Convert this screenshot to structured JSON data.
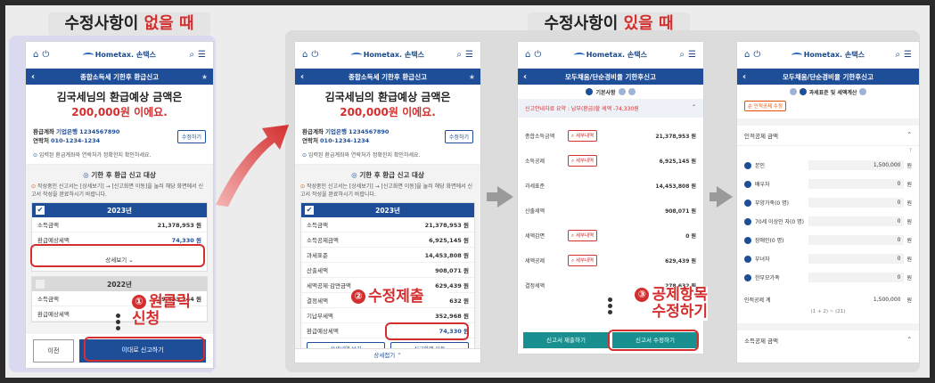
{
  "titles": {
    "left": {
      "pre": "수정사항이 ",
      "hl": "없을 때"
    },
    "right": {
      "pre": "수정사항이 ",
      "hl": "있을 때"
    }
  },
  "common": {
    "home": "홈",
    "login": "로그아웃",
    "search": "검색",
    "menu": "전체메뉴",
    "logo": "Hometax. 손택스"
  },
  "p1": {
    "nav": "종합소득세 기한후 환급신고",
    "name_line": "김국세님의 환급예상 금액은",
    "amount": "200,000원 이에요.",
    "account_label": "환급계좌",
    "account": "기업은행 1234567890",
    "phone_label": "연락처",
    "phone": "010-1234-1234",
    "edit": "수정하기",
    "notice": "입력된 환급계좌와 연락처가 정확한지 확인하세요.",
    "section": "기한 후 환급 신고 대상",
    "desc": "작성중인 신고서는 [상세보기] → [신고화면 이동]을 눌러 해당 화면에서 신고서 작성을 완료하시기 바랍니다.",
    "year1": "2023년",
    "rows1": [
      {
        "k": "소득금액",
        "v": "21,378,953 원"
      },
      {
        "k": "환급예상세액",
        "v": "74,330 원"
      }
    ],
    "detail": "상세보기",
    "year2": "2022년",
    "rows2": [
      {
        "k": "소득금액",
        "v": "19,433,244 원"
      },
      {
        "k": "환급예상세액",
        "v": ""
      }
    ],
    "prev": "이전",
    "submit": "이대로 신고하기",
    "annot_num": "①",
    "annot": "원클릭 신청"
  },
  "p2": {
    "nav": "종합소득세 기한후 환급신고",
    "name_line": "김국세님의 환급예상 금액은",
    "amount": "200,000원 이에요.",
    "account_label": "환급계좌",
    "account": "기업은행 1234567890",
    "phone_label": "연락처",
    "phone": "010-1234-1234",
    "edit": "수정하기",
    "notice": "입력된 환급계좌와 연락처가 정확한지 확인하세요.",
    "section": "기한 후 환급 신고 대상",
    "desc": "작성중인 신고서는 [상세보기] → [신고화면 이동]을 눌러 해당 화면에서 신고서 작성을 완료하시기 바랍니다.",
    "year": "2023년",
    "rows": [
      {
        "k": "소득금액",
        "v": "21,378,953 원"
      },
      {
        "k": "소득공제금액",
        "v": "6,925,145 원"
      },
      {
        "k": "과세표준",
        "v": "14,453,808 원"
      },
      {
        "k": "산출세액",
        "v": "908,071 원"
      },
      {
        "k": "세액공제·감면금액",
        "v": "629,439 원"
      },
      {
        "k": "결정세액",
        "v": "278,632 원"
      },
      {
        "k": "기납부세액",
        "v": "352,968 원"
      },
      {
        "k": "환급예상세액",
        "v": "74,330 원"
      }
    ],
    "detail_btn": "상세내역 보기",
    "move_btn": "신고화면 이동",
    "fold": "상세접기",
    "annot_num": "②",
    "annot": "수정제출"
  },
  "p3": {
    "nav": "모두채움/단순경비율 기한후신고",
    "step": "기본사항",
    "summary": "신고안내자료 요약 : 납부(환급)할 세액 -74,330원",
    "rows": [
      {
        "k": "종합소득금액",
        "tag": "세부내역",
        "v": "21,378,953 원"
      },
      {
        "k": "소득공제",
        "tag": "세부내역",
        "v": "6,925,145 원"
      },
      {
        "k": "과세표준",
        "tag": "",
        "v": "14,453,808 원"
      },
      {
        "k": "산출세액",
        "tag": "",
        "v": "908,071 원"
      },
      {
        "k": "세액감면",
        "tag": "세부내역",
        "v": "0 원"
      },
      {
        "k": "세액공제",
        "tag": "세부내역",
        "v": "629,439 원"
      },
      {
        "k": "결정세액",
        "tag": "",
        "v": "278,632 원"
      }
    ],
    "btn1": "신고서 제출하기",
    "btn2": "신고서 수정하기",
    "annot_num": "③",
    "annot": "공제항목 수정하기"
  },
  "p4": {
    "nav": "모두채움/단순경비율 기한후신고",
    "step": "과세표준 및 세액계산",
    "tag": "순 인적공제 수정",
    "sec1": "인적공제 금액",
    "rows": [
      {
        "k": "본인",
        "v": "1,500,000",
        "u": "원"
      },
      {
        "k": "배우자",
        "v": "0",
        "u": "원"
      },
      {
        "k": "부양가족(0 명)",
        "v": "0",
        "u": "원"
      },
      {
        "k": "70세 이상인 자(0 명)",
        "v": "0",
        "u": "원"
      },
      {
        "k": "장애인(0 명)",
        "v": "0",
        "u": "원"
      },
      {
        "k": "부녀자",
        "v": "0",
        "u": "원"
      },
      {
        "k": "한부모가족",
        "v": "0",
        "u": "원"
      },
      {
        "k": "인적공제 계",
        "v": "1,500,000",
        "u": "원"
      }
    ],
    "formula": "(1 + 2) ~ (21)",
    "sec2": "소득공제 금액"
  }
}
